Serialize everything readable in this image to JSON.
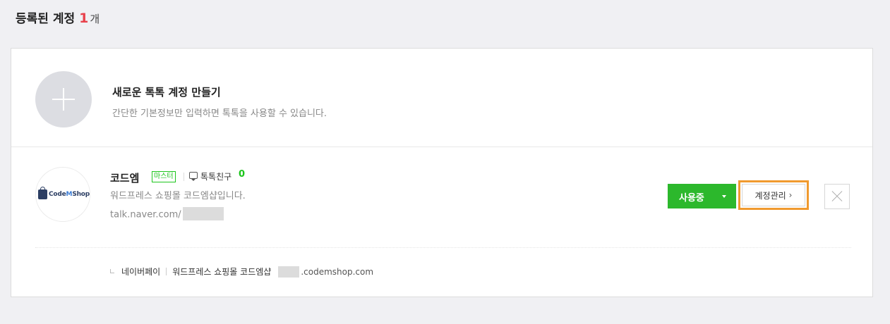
{
  "header": {
    "title": "등록된 계정",
    "count": "1",
    "unit": "개"
  },
  "create": {
    "title": "새로운 톡톡 계정 만들기",
    "description": "간단한 기본정보만 입력하면 톡톡을 사용할 수 있습니다.",
    "icon": "plus-icon"
  },
  "account": {
    "logo_prefix": "Code",
    "logo_m": "M",
    "logo_suffix": "Shop",
    "name": "코드엠",
    "role_badge": "마스터",
    "friends_label": "톡톡친구",
    "friends_count": "0",
    "description": "워드프레스 쇼핑몰 코드엠샵입니다.",
    "url_prefix": "talk.naver.com/",
    "status_button": "사용중",
    "manage_button": "계정관리",
    "manage_chevron": "›",
    "linked": {
      "service": "네이버페이",
      "store_name": "워드프레스 쇼핑몰 코드엠샵",
      "domain": ".codemshop.com"
    }
  },
  "colors": {
    "accent_red": "#e8414b",
    "green": "#2cb82c",
    "highlight_orange": "#f09a2f"
  }
}
